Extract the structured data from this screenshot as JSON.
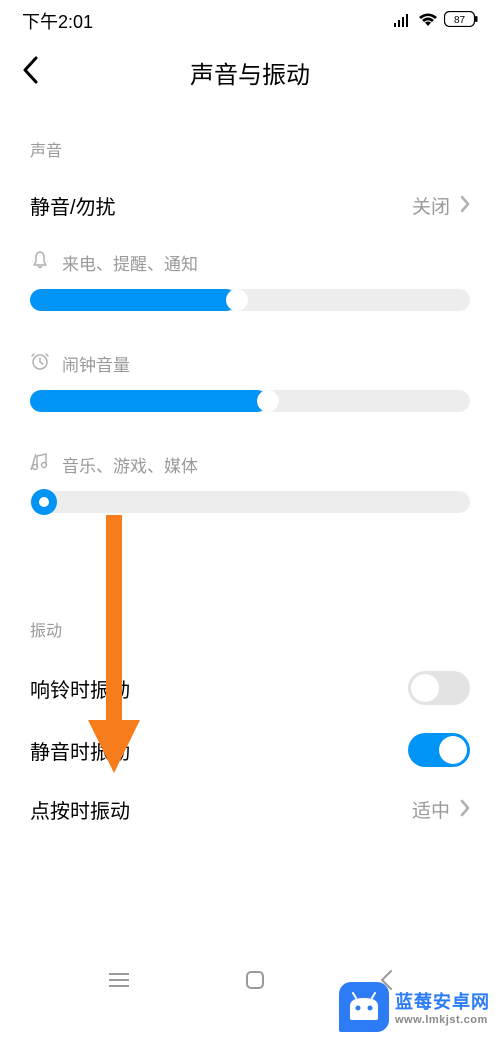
{
  "status": {
    "time": "下午2:01",
    "battery": "87"
  },
  "header": {
    "title": "声音与振动"
  },
  "sections": {
    "sound": {
      "label": "声音",
      "dnd": {
        "label": "静音/勿扰",
        "value": "关闭"
      },
      "sliders": {
        "ringtone": {
          "label": "来电、提醒、通知",
          "percent": 47
        },
        "alarm": {
          "label": "闹钟音量",
          "percent": 54
        },
        "media": {
          "label": "音乐、游戏、媒体",
          "percent": 0
        }
      }
    },
    "vibration": {
      "label": "振动",
      "ring_vibrate": {
        "label": "响铃时振动",
        "on": false
      },
      "silent_vibrate": {
        "label": "静音时振动",
        "on": true
      },
      "tap_vibrate": {
        "label": "点按时振动",
        "value": "适中"
      }
    }
  },
  "watermark": {
    "line1": "蓝莓安卓网",
    "line2": "www.lmkjst.com"
  }
}
